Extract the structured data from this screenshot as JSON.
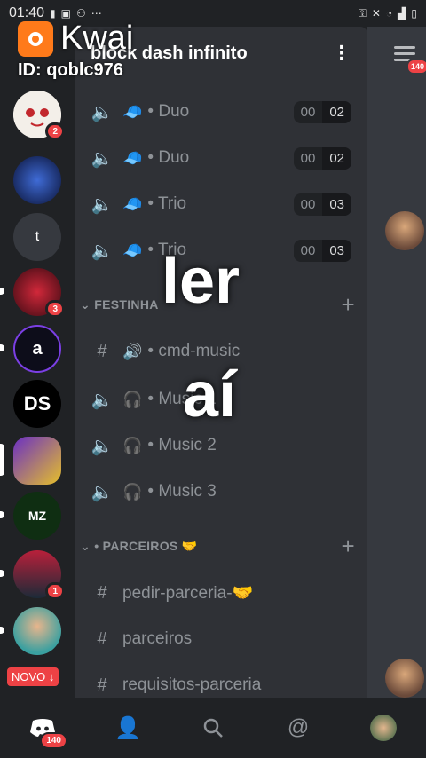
{
  "status_bar": {
    "time": "01:40",
    "left_icons": [
      "video-icon",
      "notification-icon",
      "bike-icon",
      "more-dots-icon"
    ],
    "right_icons": [
      "key-icon",
      "mute-icon",
      "wifi-icon",
      "signal-icon",
      "battery-icon"
    ],
    "dots": "⋯"
  },
  "overlay": {
    "app_name": "Kwai",
    "id_text": "ID: qoblc976",
    "caption_line1": "ler",
    "caption_line2": "aí",
    "novo_label": "NOVO ↓"
  },
  "server": {
    "name": "block dash infinito",
    "menu_glyph": "⋮"
  },
  "guilds": [
    {
      "label": "",
      "badge": "2",
      "color": "#f3efe9"
    },
    {
      "label": "",
      "badge": "",
      "color": "#142a6b"
    },
    {
      "label": "t",
      "badge": "",
      "color": "#36393f"
    },
    {
      "label": "",
      "badge": "3",
      "color": "#8a1020"
    },
    {
      "label": "a",
      "badge": "",
      "color": "#0d0d1a"
    },
    {
      "label": "DS",
      "badge": "",
      "color": "#000000"
    },
    {
      "label": "",
      "badge": "",
      "color": "#6a2fc4"
    },
    {
      "label": "MZ",
      "badge": "",
      "color": "#0f2e12"
    },
    {
      "label": "",
      "badge": "1",
      "color": "#7a1a2a"
    },
    {
      "label": "",
      "badge": "",
      "color": "#3aa0a0"
    }
  ],
  "voice_channels": [
    {
      "name": "Duo",
      "emoji": "🧢",
      "current": "00",
      "max": "02"
    },
    {
      "name": "Duo",
      "emoji": "🧢",
      "current": "00",
      "max": "02"
    },
    {
      "name": "Trio",
      "emoji": "🧢",
      "current": "00",
      "max": "03"
    },
    {
      "name": "Trio",
      "emoji": "🧢",
      "current": "00",
      "max": "03"
    }
  ],
  "categories": [
    {
      "name": "FESTINHA",
      "plus": "+"
    },
    {
      "name": "PARCEIROS 🤝",
      "plus": "+"
    }
  ],
  "festinha_channels": [
    {
      "type": "text",
      "name": "cmd-music",
      "emoji": "🔊"
    },
    {
      "type": "voice",
      "name": "Music 1",
      "emoji": "🎧"
    },
    {
      "type": "voice",
      "name": "Music 2",
      "emoji": "🎧"
    },
    {
      "type": "voice",
      "name": "Music 3",
      "emoji": "🎧"
    }
  ],
  "parceiros_channels": [
    {
      "name": "pedir-parceria-🤝"
    },
    {
      "name": "parceiros"
    },
    {
      "name": "requisitos-parceria"
    }
  ],
  "right_panel": {
    "badge": "140"
  },
  "bottom_nav": {
    "home_badge": "140",
    "items": [
      "discord-home-icon",
      "friends-icon",
      "search-icon",
      "mentions-icon",
      "profile-avatar"
    ]
  },
  "colors": {
    "background": "#202225",
    "panel": "#2f3136",
    "accent_red": "#ed4245"
  }
}
